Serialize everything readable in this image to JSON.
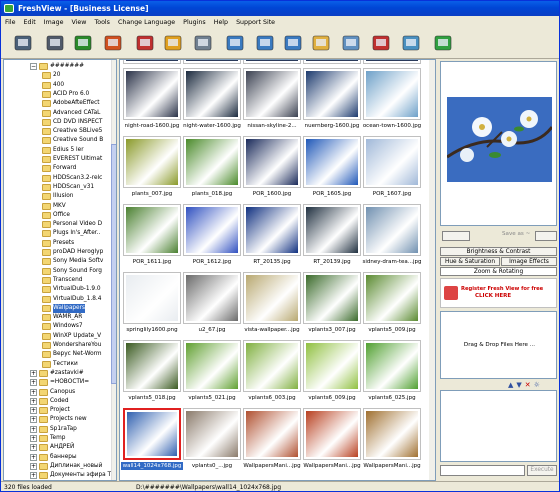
{
  "window": {
    "title": "FreshView - [Business License]"
  },
  "menu": [
    "File",
    "Edit",
    "Image",
    "View",
    "Tools",
    "Change Language",
    "Plugins",
    "Help",
    "Support Site"
  ],
  "toolbar": {
    "icons": [
      "scan-icon",
      "print-icon",
      "refresh-icon",
      "folder-export-icon",
      "cut-icon",
      "paste-icon",
      "copy-icon",
      "image-icon",
      "image-info-icon",
      "image-list-icon",
      "image-transfer-icon",
      "slideshow-icon",
      "select-icon",
      "wallpaper-icon",
      "plugins-icon"
    ]
  },
  "tree": {
    "items": [
      {
        "label": "#######",
        "exp": "-",
        "level": 1
      },
      {
        "label": "20",
        "level": 2
      },
      {
        "label": "400",
        "level": 2
      },
      {
        "label": "ACID Pro 6.0",
        "level": 2
      },
      {
        "label": "AdobeAfteEffect",
        "level": 2
      },
      {
        "label": "Advanced CATaL",
        "level": 2
      },
      {
        "label": "CD DVD INSPECT",
        "level": 2
      },
      {
        "label": "Creative SBLive5",
        "level": 2
      },
      {
        "label": "Creative Sound B",
        "level": 2
      },
      {
        "label": "Edius 5 ler",
        "level": 2
      },
      {
        "label": "EVEREST Ultimat",
        "level": 2
      },
      {
        "label": "Forward",
        "level": 2
      },
      {
        "label": "HDDScan3.2-relc",
        "level": 2
      },
      {
        "label": "HDDScan_v31",
        "level": 2
      },
      {
        "label": "Illusion",
        "level": 2
      },
      {
        "label": "MKV",
        "level": 2
      },
      {
        "label": "Office",
        "level": 2
      },
      {
        "label": "Personal Video D",
        "level": 2
      },
      {
        "label": "Plugs In's_After..",
        "level": 2
      },
      {
        "label": "Presets",
        "level": 2
      },
      {
        "label": "proDAD Heroglyp",
        "level": 2
      },
      {
        "label": "Sony Media Softv",
        "level": 2
      },
      {
        "label": "Sony Sound Forg",
        "level": 2
      },
      {
        "label": "Transcend",
        "level": 2
      },
      {
        "label": "VirtualDub-1.9.0",
        "level": 2
      },
      {
        "label": "VirtualDub_1.8.4",
        "level": 2
      },
      {
        "label": "Wallpapers",
        "level": 2,
        "selected": true
      },
      {
        "label": "WAMR_AR",
        "level": 2
      },
      {
        "label": "Windows7",
        "level": 2
      },
      {
        "label": "WinXP Update_V",
        "level": 2
      },
      {
        "label": "WondershareYou",
        "level": 2
      },
      {
        "label": "Bepyc Net-Worm",
        "level": 2
      },
      {
        "label": "Тестики",
        "level": 2
      },
      {
        "label": "#zastavki#",
        "exp": "+",
        "level": 1
      },
      {
        "label": "=НОВОСТИ=",
        "exp": "+",
        "level": 1
      },
      {
        "label": "Canopus",
        "exp": "+",
        "level": 1
      },
      {
        "label": "Coded",
        "exp": "+",
        "level": 1
      },
      {
        "label": "Project",
        "exp": "+",
        "level": 1
      },
      {
        "label": "Projects new",
        "exp": "+",
        "level": 1
      },
      {
        "label": "Sp1raTap",
        "exp": "+",
        "level": 1
      },
      {
        "label": "Temp",
        "exp": "+",
        "level": 1
      },
      {
        "label": "АНДРЕЙ",
        "exp": "+",
        "level": 1
      },
      {
        "label": "баннеры",
        "exp": "+",
        "level": 1
      },
      {
        "label": "Диплинак_новый",
        "exp": "+",
        "level": 1
      },
      {
        "label": "Документы эфира Т",
        "exp": "+",
        "level": 1
      }
    ]
  },
  "thumbnails": {
    "top_row_partial": [
      "...",
      "...",
      "...",
      "...",
      "..."
    ],
    "rows": [
      [
        "night-road-1600.jpg",
        "night-water-1600.jpg",
        "nissan-skyline-2...",
        "nuernberg-1600.jpg",
        "ocean-town-1600.jpg"
      ],
      [
        "plants_007.jpg",
        "plants_018.jpg",
        "POR_1600.jpg",
        "POR_1605.jpg",
        "POR_1607.jpg"
      ],
      [
        "POR_1611.jpg",
        "POR_1612.jpg",
        "RT_20135.jpg",
        "RT_20139.jpg",
        "sidney-dram-tea...jpg"
      ],
      [
        "springlily1600.png",
        "u2_67.jpg",
        "vista-wallpaper...jpg",
        "vplants3_007.jpg",
        "vplants5_009.jpg"
      ],
      [
        "vplants5_018.jpg",
        "vplants5_021.jpg",
        "vplants6_003.jpg",
        "vplants6_009.jpg",
        "vplants6_025.jpg"
      ],
      [
        "wall14_1024x768.jpg",
        "vplants0_...jpg",
        "WallpapersMani...jpg",
        "WallpapersMani...jpg",
        "WallpapersMani...jpg"
      ]
    ],
    "selected": "wall14_1024x768.jpg",
    "colors": [
      [
        "#2a3248",
        "#1b2a3e",
        "#3a4050",
        "#1c3a6e",
        "#6da0c8"
      ],
      [
        "#8a9a2a",
        "#4a8a2a",
        "#1a2a5a",
        "#2058b8",
        "#a0b8d8"
      ],
      [
        "#4a8030",
        "#3050c0",
        "#103080",
        "#203040",
        "#7090b0"
      ],
      [
        "#e8ecf0",
        "#6a6a6a",
        "#b8a870",
        "#3a6a2a",
        "#5a8a30"
      ],
      [
        "#3a5a20",
        "#60a030",
        "#80b040",
        "#90c040",
        "#50a030"
      ],
      [
        "#3060b0",
        "#8a7a6a",
        "#b05030",
        "#b84020",
        "#a07030"
      ]
    ]
  },
  "right_panel": {
    "save_as": "Save as ~",
    "buttons": [
      "Brightness & Contrast",
      "Hue & Saturation",
      "Image Effects",
      "Zoom & Rotating"
    ],
    "register": "Register Fresh View for free",
    "click_here": "CLICK HERE",
    "drag_drop": "Drag & Drop Files Here ...",
    "execute": "Execute"
  },
  "status": {
    "count": "320 files loaded",
    "path": "D:\\#######\\Wallpapers\\wall14_1024x768.jpg"
  }
}
